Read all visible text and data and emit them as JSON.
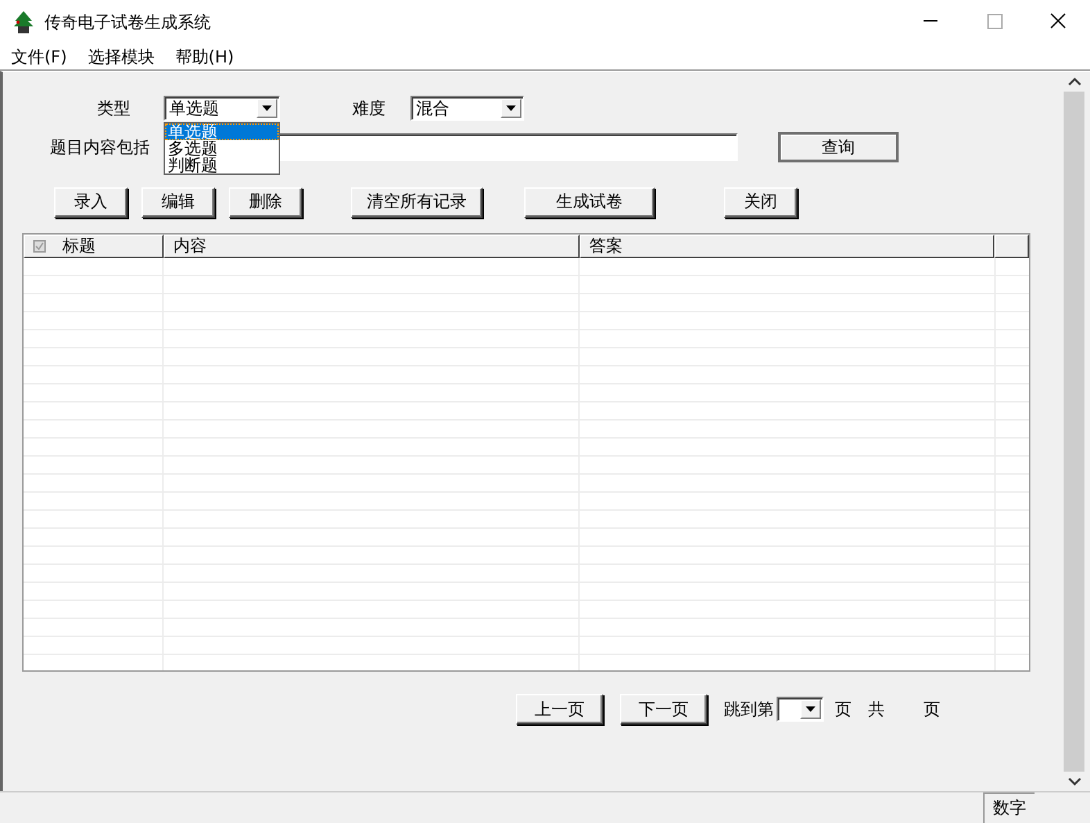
{
  "window": {
    "title": "传奇电子试卷生成系统"
  },
  "menu": [
    "文件(F)",
    "选择模块",
    "帮助(H)"
  ],
  "filters": {
    "type": {
      "label": "类型",
      "value": "单选题",
      "expanded": true,
      "options": [
        {
          "label": "单选题",
          "selected": true
        },
        {
          "label": "多选题",
          "selected": false
        },
        {
          "label": "判断题",
          "selected": false
        }
      ]
    },
    "difficulty": {
      "label": "难度",
      "value": "混合"
    },
    "content": {
      "label": "题目内容包括"
    },
    "search_button": "查询"
  },
  "toolbar": [
    "录入",
    "编辑",
    "删除",
    "清空所有记录",
    "生成试卷",
    "关闭"
  ],
  "table": {
    "columns": [
      "标题",
      "内容",
      "答案"
    ]
  },
  "pager": {
    "prev": "上一页",
    "next": "下一页",
    "jump_label": "跳到第",
    "page_unit": "页",
    "total_label": "共",
    "total_unit": "页"
  },
  "status_bar": {
    "panel": "数字"
  }
}
